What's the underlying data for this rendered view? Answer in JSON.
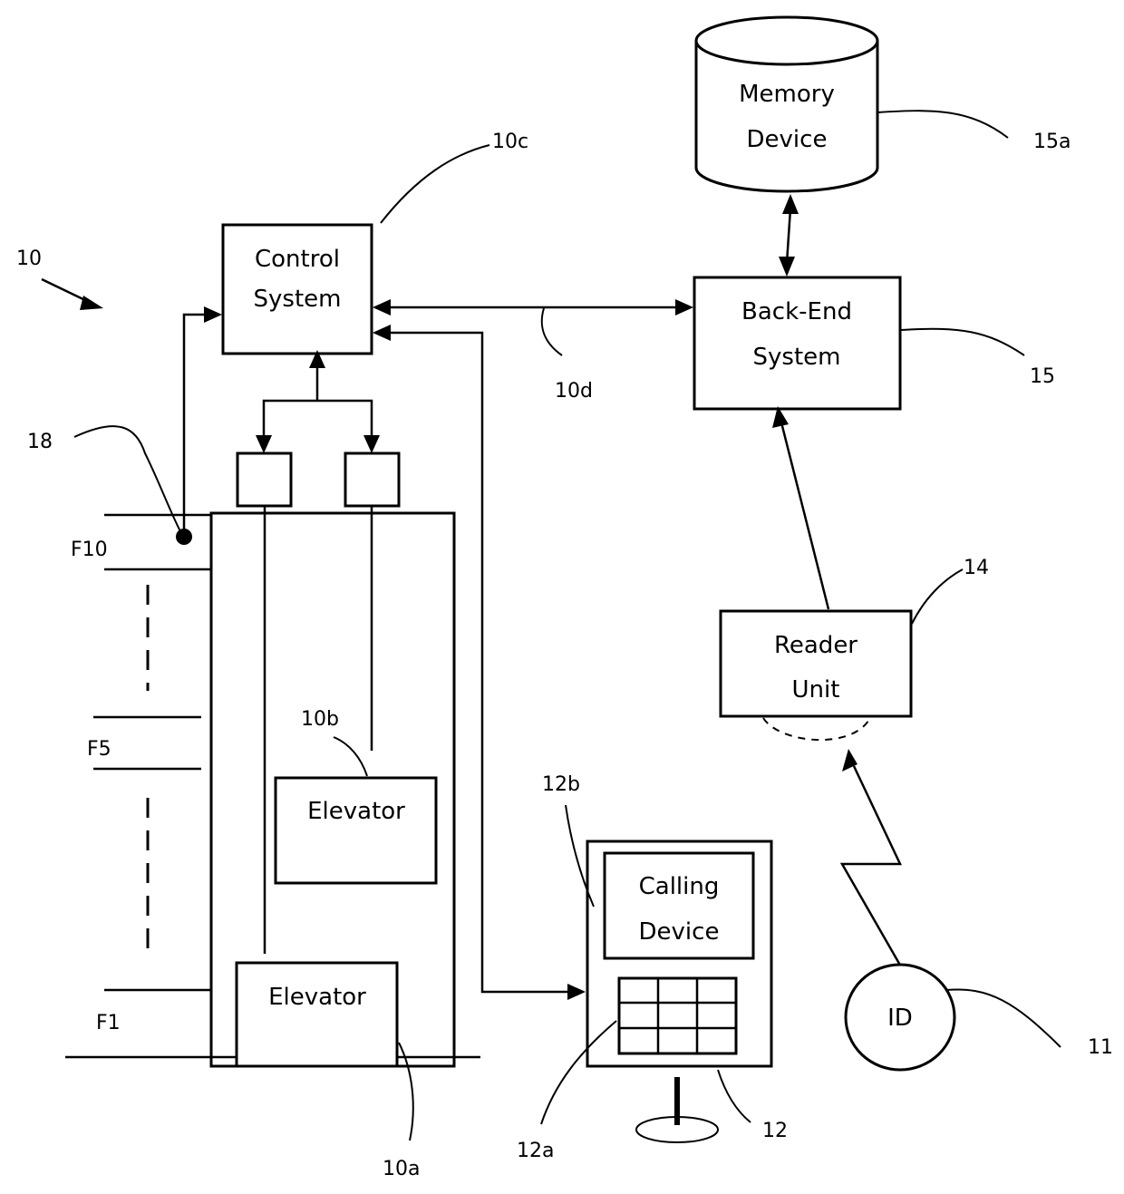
{
  "figure": {
    "system_ref": "10",
    "components": {
      "memory_device": {
        "line1": "Memory",
        "line2": "Device",
        "ref": "15a"
      },
      "back_end_system": {
        "line1": "Back-End",
        "line2": "System",
        "ref": "15"
      },
      "control_system": {
        "line1": "Control",
        "line2": "System",
        "ref": "10c"
      },
      "network_link": {
        "ref": "10d"
      },
      "reader_unit": {
        "line1": "Reader",
        "line2": "Unit",
        "ref": "14"
      },
      "elevator_upper": {
        "label": "Elevator",
        "ref": "10b"
      },
      "elevator_lower": {
        "label": "Elevator",
        "ref": "10a"
      },
      "calling_device": {
        "line1": "Calling",
        "line2": "Device",
        "ref": "12",
        "screen_ref": "12b",
        "keypad_ref": "12a"
      },
      "id_token": {
        "label": "ID",
        "ref": "11"
      },
      "sensor": {
        "ref": "18"
      }
    },
    "floors": [
      "F10",
      "F5",
      "F1"
    ]
  }
}
